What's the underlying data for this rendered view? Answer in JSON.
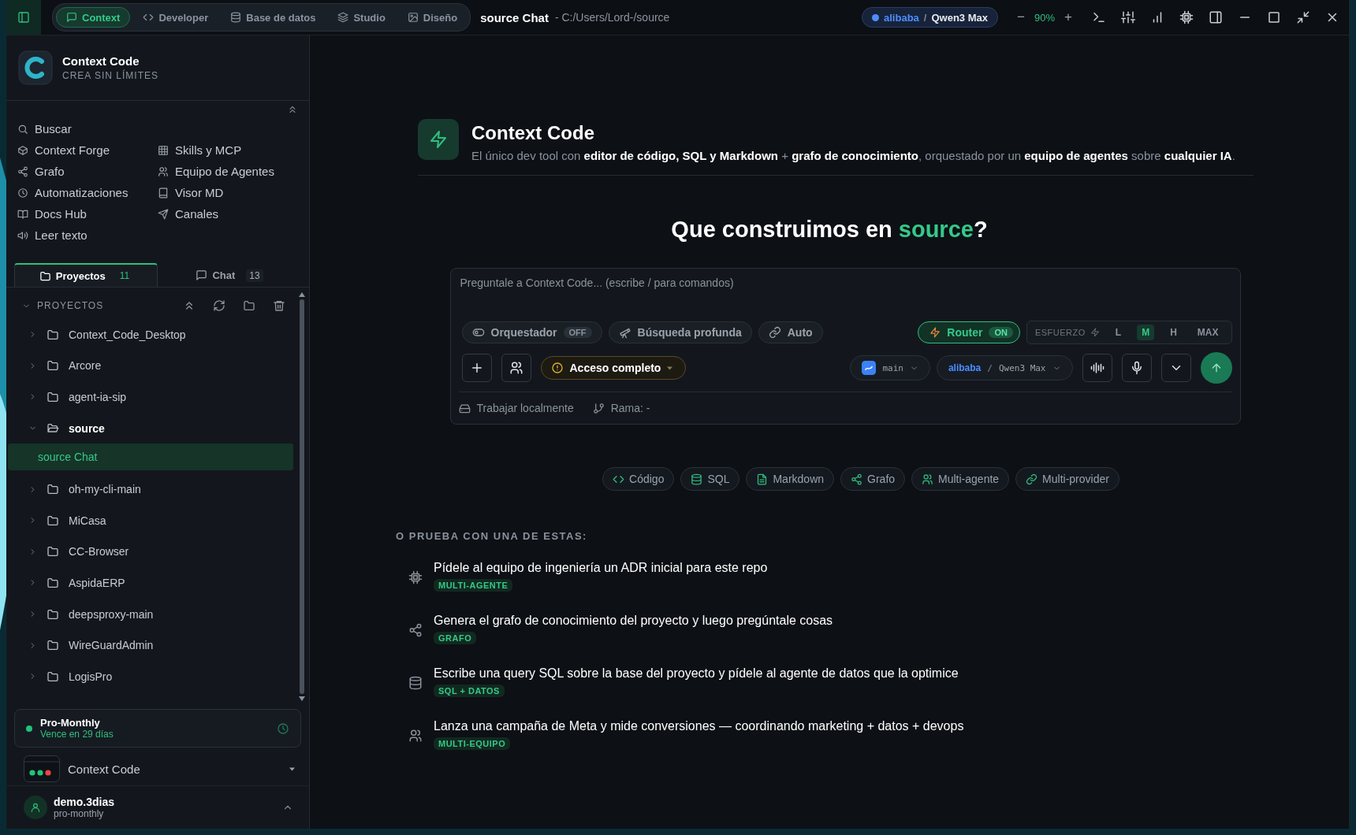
{
  "title_bar": {
    "modes": [
      {
        "label": "Context",
        "selected": true
      },
      {
        "label": "Developer",
        "selected": false
      },
      {
        "label": "Base de datos",
        "selected": false
      },
      {
        "label": "Studio",
        "selected": false
      },
      {
        "label": "Diseño",
        "selected": false
      }
    ],
    "title": "source Chat",
    "path": "- C:/Users/Lord-/source",
    "model": {
      "provider": "alibaba",
      "separator": "/",
      "name": "Qwen3 Max"
    },
    "zoom": {
      "minus": "−",
      "value": "90%",
      "plus": "+"
    }
  },
  "sidebar": {
    "app_name": "Context Code",
    "tagline": "CREA SIN LÍMITES",
    "nav_left": [
      {
        "label": "Buscar"
      },
      {
        "label": "Context Forge"
      },
      {
        "label": "Grafo"
      },
      {
        "label": "Automatizaciones"
      },
      {
        "label": "Docs Hub"
      },
      {
        "label": "Leer texto"
      }
    ],
    "nav_right": [
      {
        "label": "Skills y MCP"
      },
      {
        "label": "Equipo de Agentes"
      },
      {
        "label": "Visor MD"
      },
      {
        "label": "Canales"
      }
    ],
    "tabs": [
      {
        "label": "Proyectos",
        "count": "11",
        "selected": true
      },
      {
        "label": "Chat",
        "count": "13",
        "selected": false
      }
    ],
    "projects": {
      "header": "PROYECTOS",
      "items": [
        {
          "name": "Context_Code_Desktop",
          "expanded": false
        },
        {
          "name": "Arcore",
          "expanded": false
        },
        {
          "name": "agent-ia-sip",
          "expanded": false
        },
        {
          "name": "source",
          "expanded": true,
          "children": [
            {
              "name": "source Chat",
              "selected": true
            }
          ]
        },
        {
          "name": "oh-my-cli-main",
          "expanded": false
        },
        {
          "name": "MiCasa",
          "expanded": false
        },
        {
          "name": "CC-Browser",
          "expanded": false
        },
        {
          "name": "AspidaERP",
          "expanded": false
        },
        {
          "name": "deepsproxy-main",
          "expanded": false
        },
        {
          "name": "WireGuardAdmin",
          "expanded": false
        },
        {
          "name": "LogisPro",
          "expanded": false
        }
      ]
    },
    "plan": {
      "name": "Pro-Monthly",
      "expires": "Vence en 29 días"
    },
    "workspace": {
      "name": "Context Code"
    },
    "user": {
      "name": "demo.3dias",
      "plan": "pro-monthly"
    }
  },
  "main": {
    "hero": {
      "title": "Context Code",
      "description": "El único dev tool con **editor de código, SQL y Markdown** + **grafo de conocimiento**, orquestado por un **equipo de agentes** sobre **cualquier IA**."
    },
    "question": {
      "before": "Que construimos en ",
      "highlight": "source",
      "after": "?"
    },
    "composer": {
      "placeholder": "Preguntale a Context Code... (escribe / para comandos)",
      "toggles": [
        {
          "label": "Orquestador",
          "kind": "switch",
          "on": false,
          "state": "OFF"
        },
        {
          "label": "Búsqueda profunda",
          "kind": "plain"
        },
        {
          "label": "Auto",
          "kind": "plain"
        }
      ],
      "router": {
        "label": "Router",
        "on": true,
        "state": "ON"
      },
      "effort": {
        "label": "ESFUERZO",
        "levels": [
          {
            "label": "L",
            "selected": false
          },
          {
            "label": "M",
            "selected": true
          },
          {
            "label": "H",
            "selected": false
          },
          {
            "label": "MAX",
            "selected": false
          }
        ]
      },
      "access": "Acceso completo",
      "branch": "main",
      "model": {
        "provider": "alibaba",
        "separator": "/",
        "name": "Qwen3 Max"
      },
      "footer": {
        "location": "Trabajar localmente",
        "branch": "Rama: -"
      }
    },
    "chips": [
      {
        "label": "Código"
      },
      {
        "label": "SQL"
      },
      {
        "label": "Markdown"
      },
      {
        "label": "Grafo"
      },
      {
        "label": "Multi-agente"
      },
      {
        "label": "Multi-provider"
      }
    ],
    "suggestions": {
      "heading": "O PRUEBA CON UNA DE ESTAS:",
      "items": [
        {
          "text": "Pídele al equipo de ingeniería un ADR inicial para este repo",
          "tag": "MULTI-AGENTE"
        },
        {
          "text": "Genera el grafo de conocimiento del proyecto y luego pregúntale cosas",
          "tag": "GRAFO"
        },
        {
          "text": "Escribe una query SQL sobre la base del proyecto y pídele al agente de datos que la optimice",
          "tag": "SQL + DATOS"
        },
        {
          "text": "Lanza una campaña de Meta y mide conversiones — coordinando marketing + datos + devops",
          "tag": "MULTI-EQUIPO"
        }
      ]
    }
  }
}
